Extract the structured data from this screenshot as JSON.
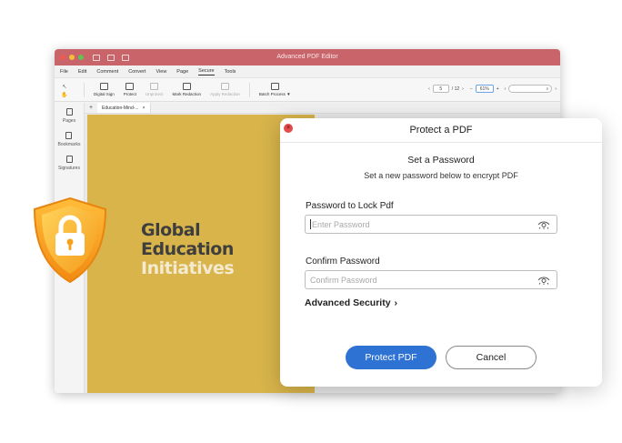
{
  "window": {
    "title": "Advanced PDF Editor"
  },
  "menu": [
    "File",
    "Edit",
    "Comment",
    "Convert",
    "View",
    "Page",
    "Secure",
    "Tools"
  ],
  "menu_active": "Secure",
  "toolbar": {
    "tools": [
      {
        "label": "Digital Sign",
        "icon": "digital-sign-icon",
        "enabled": true
      },
      {
        "label": "Protect",
        "icon": "lock-icon",
        "enabled": true
      },
      {
        "label": "Unprotect",
        "icon": "unlock-icon",
        "enabled": false
      },
      {
        "label": "Mark Redaction",
        "icon": "mark-redaction-icon",
        "enabled": true
      },
      {
        "label": "Apply Redaction",
        "icon": "apply-redaction-icon",
        "enabled": false
      },
      {
        "label": "Batch Process ▼",
        "icon": "batch-process-icon",
        "enabled": true
      }
    ],
    "page_current": "5",
    "page_total": "/ 12",
    "zoom": "61%"
  },
  "sidebar": {
    "items": [
      {
        "label": "Pages",
        "icon": "pages-icon"
      },
      {
        "label": "Bookmarks",
        "icon": "bookmark-icon"
      },
      {
        "label": "Signatures",
        "icon": "signature-icon"
      }
    ]
  },
  "tab": {
    "label": "Education-Mind-..."
  },
  "document": {
    "line1": "Global",
    "line2": "Education",
    "line3": "Initiatives"
  },
  "dialog": {
    "title": "Protect a PDF",
    "heading": "Set a Password",
    "subheading": "Set a new password below to encrypt PDF",
    "password_label": "Password to Lock Pdf",
    "password_placeholder": "Enter Password",
    "confirm_label": "Confirm Password",
    "confirm_placeholder": "Confirm Password",
    "advanced_label": "Advanced Security",
    "protect_button": "Protect PDF",
    "cancel_button": "Cancel"
  },
  "colors": {
    "titlebar": "#c8646a",
    "document_bg": "#d8b44b",
    "primary": "#2e72d3",
    "shield": "#f5a21b"
  }
}
